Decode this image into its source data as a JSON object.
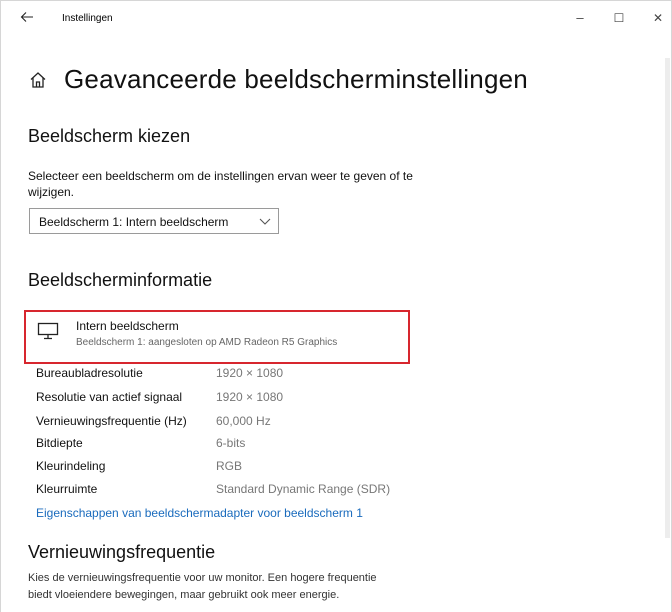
{
  "window": {
    "title": "Instellingen",
    "back_icon": "arrow-left-icon",
    "minimize_glyph": "–",
    "maximize_glyph": "☐",
    "close_glyph": "✕"
  },
  "page": {
    "title": "Geavanceerde beeldscherminstellingen",
    "title_icon": "home-icon"
  },
  "choose_display": {
    "heading": "Beeldscherm kiezen",
    "description_line1": "Selecteer een beeldscherm om de instellingen ervan weer te geven of te",
    "description_line2": "wijzigen.",
    "selected": "Beeldscherm 1: Intern beeldscherm"
  },
  "display_info": {
    "heading": "Beeldscherminformatie",
    "monitor_name": "Intern beeldscherm",
    "monitor_sub": "Beeldscherm 1: aangesloten op AMD Radeon R5 Graphics",
    "rows": [
      {
        "label": "Bureaubladresolutie",
        "value": "1920 × 1080"
      },
      {
        "label": "Resolutie van actief signaal",
        "value": "1920 × 1080"
      },
      {
        "label": "Vernieuwingsfrequentie (Hz)",
        "value": "60,000 Hz"
      },
      {
        "label": "Bitdiepte",
        "value": "6-bits"
      },
      {
        "label": "Kleurindeling",
        "value": "RGB"
      },
      {
        "label": "Kleurruimte",
        "value": "Standard Dynamic Range (SDR)"
      }
    ],
    "adapter_link": "Eigenschappen van beeldschermadapter voor beeldscherm 1"
  },
  "refresh": {
    "heading": "Vernieuwingsfrequentie",
    "description_line1": "Kies de vernieuwingsfrequentie voor uw monitor. Een hogere frequentie",
    "description_line2": "biedt vloeiendere bewegingen, maar gebruikt ook meer energie."
  },
  "colors": {
    "highlight_border": "#d7262e",
    "link": "#1a6bbd"
  }
}
